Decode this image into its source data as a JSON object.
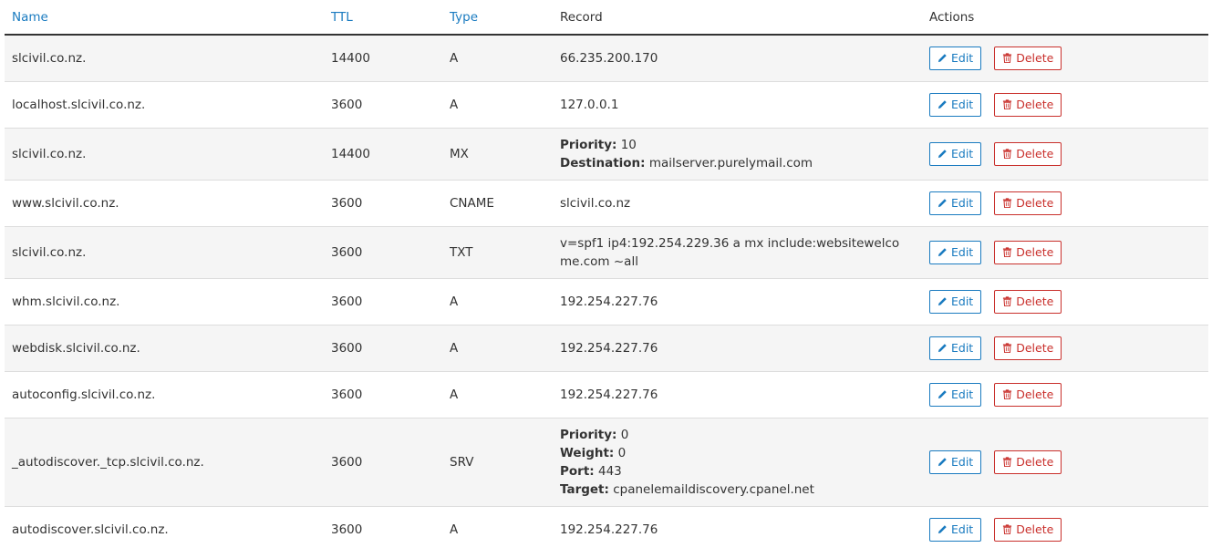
{
  "columns": {
    "name": "Name",
    "ttl": "TTL",
    "type": "Type",
    "record": "Record",
    "actions": "Actions"
  },
  "actions": {
    "edit": "Edit",
    "delete": "Delete"
  },
  "colors": {
    "link": "#1a7bc0",
    "danger": "#c9302c",
    "stripe": "#f5f5f5"
  },
  "icons": {
    "edit": "pencil-icon",
    "delete": "trash-icon"
  },
  "records": [
    {
      "name": "slcivil.co.nz.",
      "ttl": "14400",
      "type": "A",
      "record": [
        {
          "value": "66.235.200.170"
        }
      ]
    },
    {
      "name": "localhost.slcivil.co.nz.",
      "ttl": "3600",
      "type": "A",
      "record": [
        {
          "value": "127.0.0.1"
        }
      ]
    },
    {
      "name": "slcivil.co.nz.",
      "ttl": "14400",
      "type": "MX",
      "record": [
        {
          "key": "Priority:",
          "value": "10"
        },
        {
          "key": "Destination:",
          "value": "mailserver.purelymail.com"
        }
      ]
    },
    {
      "name": "www.slcivil.co.nz.",
      "ttl": "3600",
      "type": "CNAME",
      "record": [
        {
          "value": "slcivil.co.nz"
        }
      ]
    },
    {
      "name": "slcivil.co.nz.",
      "ttl": "3600",
      "type": "TXT",
      "record": [
        {
          "value": "v=spf1 ip4:192.254.229.36 a mx include:websitewelcome.com ~all"
        }
      ]
    },
    {
      "name": "whm.slcivil.co.nz.",
      "ttl": "3600",
      "type": "A",
      "record": [
        {
          "value": "192.254.227.76"
        }
      ]
    },
    {
      "name": "webdisk.slcivil.co.nz.",
      "ttl": "3600",
      "type": "A",
      "record": [
        {
          "value": "192.254.227.76"
        }
      ]
    },
    {
      "name": "autoconfig.slcivil.co.nz.",
      "ttl": "3600",
      "type": "A",
      "record": [
        {
          "value": "192.254.227.76"
        }
      ]
    },
    {
      "name": "_autodiscover._tcp.slcivil.co.nz.",
      "ttl": "3600",
      "type": "SRV",
      "record": [
        {
          "key": "Priority:",
          "value": "0"
        },
        {
          "key": "Weight:",
          "value": "0"
        },
        {
          "key": "Port:",
          "value": "443"
        },
        {
          "key": "Target:",
          "value": "cpanelemaildiscovery.cpanel.net"
        }
      ]
    },
    {
      "name": "autodiscover.slcivil.co.nz.",
      "ttl": "3600",
      "type": "A",
      "record": [
        {
          "value": "192.254.227.76"
        }
      ]
    }
  ]
}
